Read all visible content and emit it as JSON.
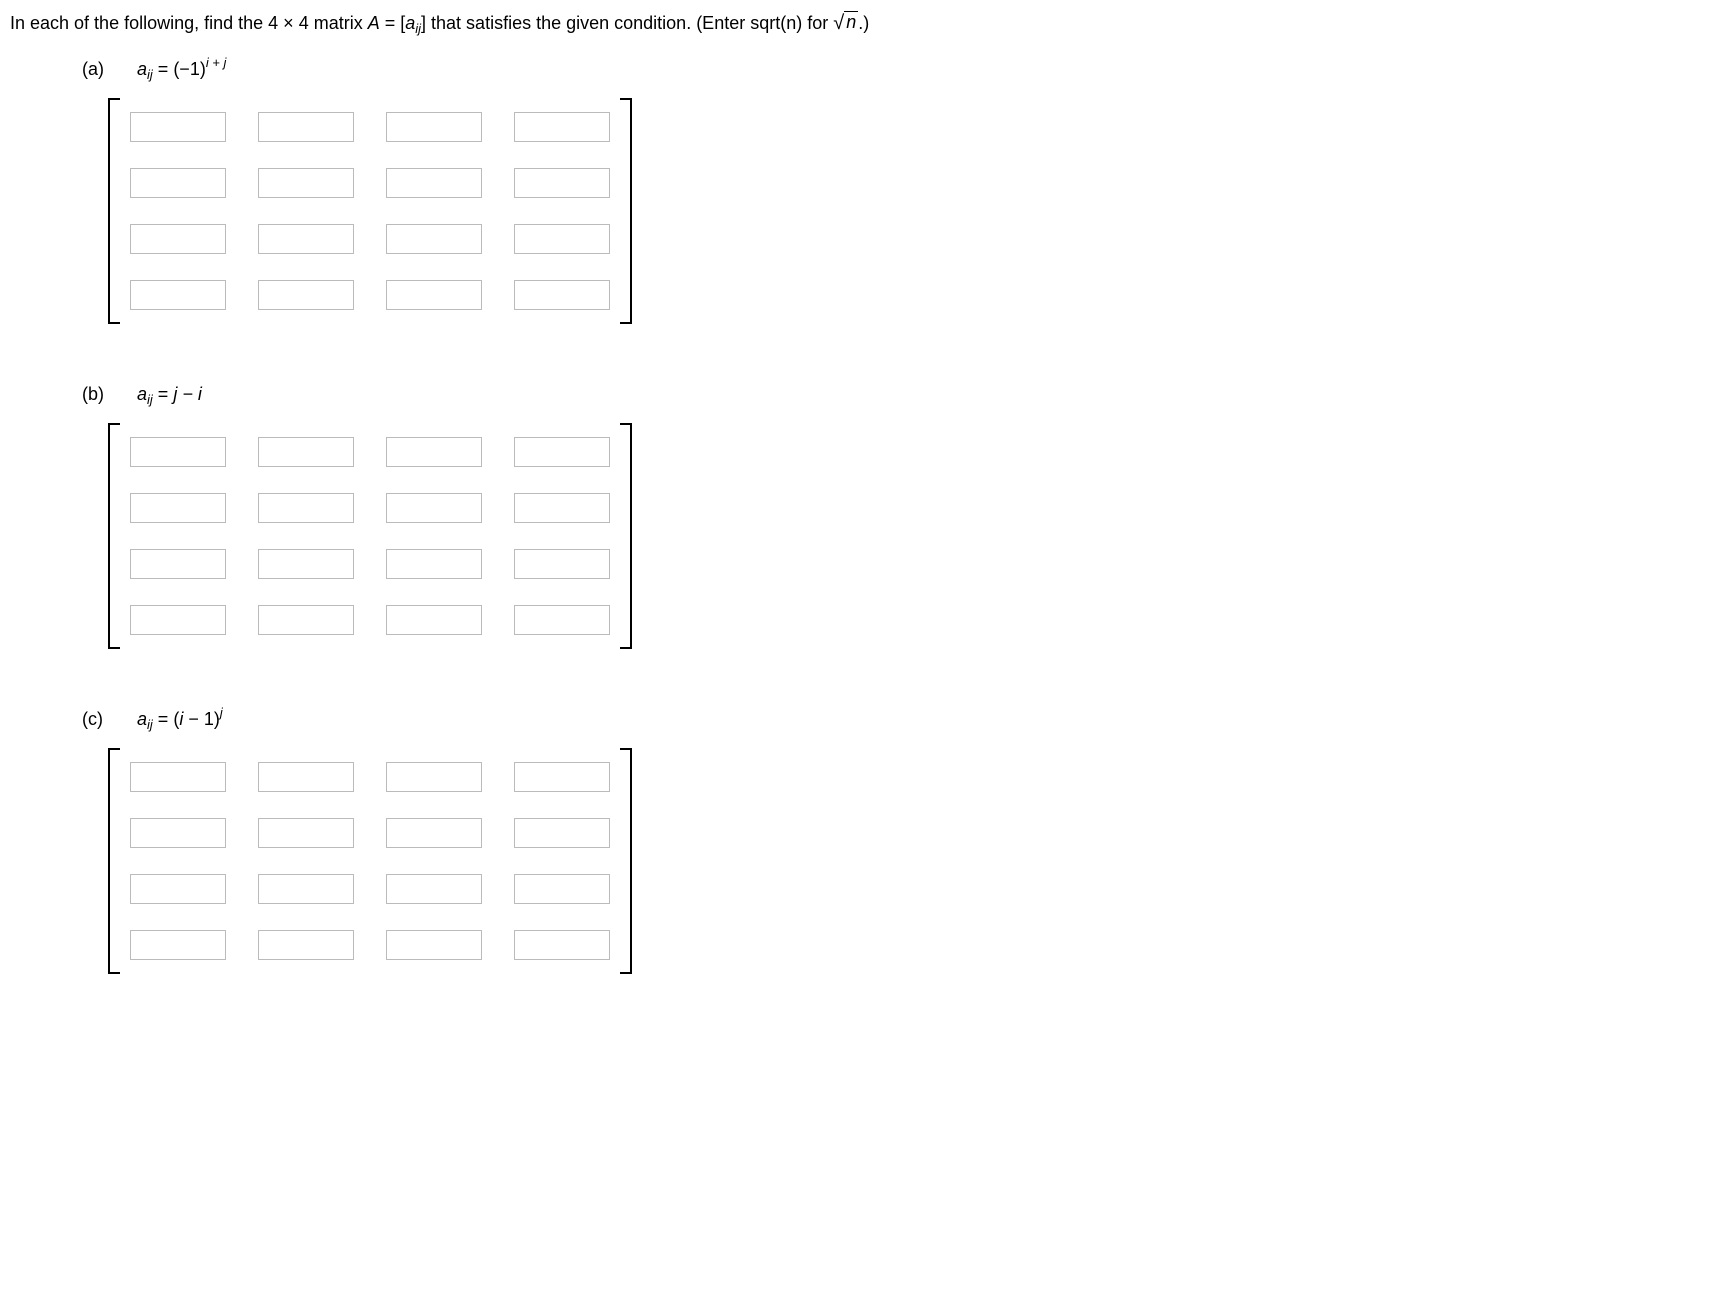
{
  "intro_prefix": "In each of the following, find the  4 × 4  matrix  ",
  "intro_A": "A",
  "intro_eq": " = [",
  "intro_a": "a",
  "intro_ij": "ij",
  "intro_close": "]  that satisfies the given condition. (Enter sqrt(n) for ",
  "intro_sqrt_arg": "n",
  "intro_end": ".)",
  "parts": {
    "a": {
      "label": "(a)",
      "formula": {
        "lhs_a": "a",
        "lhs_ij": "ij",
        "eq": " = ",
        "base": "(−1)",
        "exp": "i + j"
      },
      "cells": [
        "",
        "",
        "",
        "",
        "",
        "",
        "",
        "",
        "",
        "",
        "",
        "",
        "",
        "",
        "",
        ""
      ]
    },
    "b": {
      "label": "(b)",
      "formula": {
        "lhs_a": "a",
        "lhs_ij": "ij",
        "eq": " = ",
        "rhs": "j − i"
      },
      "cells": [
        "",
        "",
        "",
        "",
        "",
        "",
        "",
        "",
        "",
        "",
        "",
        "",
        "",
        "",
        "",
        ""
      ]
    },
    "c": {
      "label": "(c)",
      "formula": {
        "lhs_a": "a",
        "lhs_ij": "ij",
        "eq": " = ",
        "base": "(",
        "base_i": "i",
        "mid": " − 1)",
        "exp": "j"
      },
      "cells": [
        "",
        "",
        "",
        "",
        "",
        "",
        "",
        "",
        "",
        "",
        "",
        "",
        "",
        "",
        "",
        ""
      ]
    }
  }
}
